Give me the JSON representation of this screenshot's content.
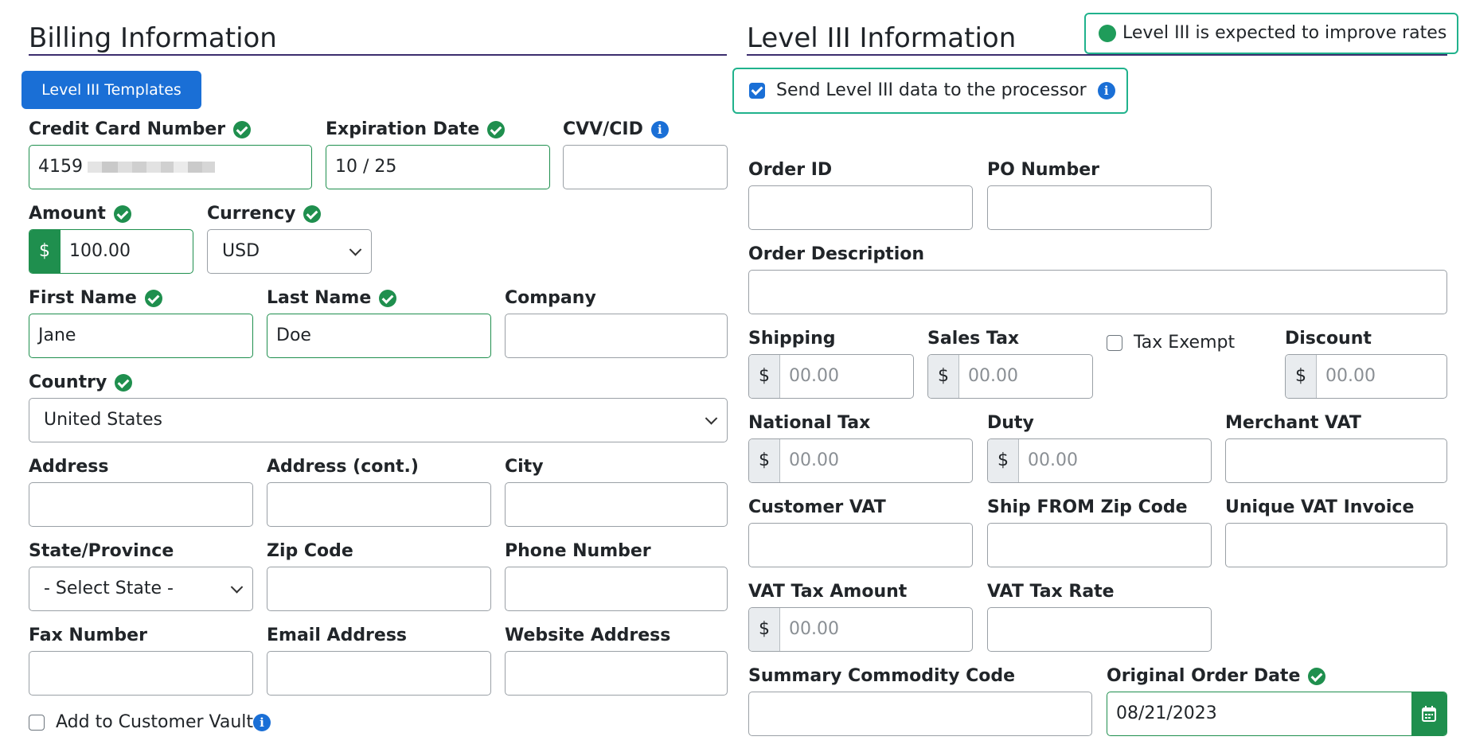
{
  "billing": {
    "title": "Billing Information",
    "templates_button": "Level III Templates",
    "fields": {
      "credit_card_number": {
        "label": "Credit Card Number",
        "value": "4159"
      },
      "expiration_date": {
        "label": "Expiration Date",
        "value": "10 / 25"
      },
      "cvv": {
        "label": "CVV/CID",
        "value": ""
      },
      "amount": {
        "label": "Amount",
        "currency_symbol": "$",
        "value": "100.00"
      },
      "currency": {
        "label": "Currency",
        "value": "USD"
      },
      "first_name": {
        "label": "First Name",
        "value": "Jane"
      },
      "last_name": {
        "label": "Last Name",
        "value": "Doe"
      },
      "company": {
        "label": "Company",
        "value": ""
      },
      "country": {
        "label": "Country",
        "value": "United States"
      },
      "address": {
        "label": "Address",
        "value": ""
      },
      "address_cont": {
        "label": "Address (cont.)",
        "value": ""
      },
      "city": {
        "label": "City",
        "value": ""
      },
      "state": {
        "label": "State/Province",
        "value": "- Select State -"
      },
      "zip": {
        "label": "Zip Code",
        "value": ""
      },
      "phone": {
        "label": "Phone Number",
        "value": ""
      },
      "fax": {
        "label": "Fax Number",
        "value": ""
      },
      "email": {
        "label": "Email Address",
        "value": ""
      },
      "website": {
        "label": "Website Address",
        "value": ""
      }
    },
    "add_to_vault": {
      "label": "Add to Customer Vault",
      "checked": false
    }
  },
  "level3": {
    "title": "Level III Information",
    "notice": "Level III is expected to improve rates",
    "send_checkbox": {
      "label": "Send Level III data to the processor",
      "checked": true
    },
    "currency_symbol": "$",
    "amount_placeholder": "00.00",
    "fields": {
      "order_id": "Order ID",
      "po_number": "PO Number",
      "order_description": "Order Description",
      "shipping": "Shipping",
      "sales_tax": "Sales Tax",
      "tax_exempt": "Tax Exempt",
      "discount": "Discount",
      "national_tax": "National Tax",
      "duty": "Duty",
      "merchant_vat": "Merchant VAT",
      "customer_vat": "Customer VAT",
      "ship_from_zip": "Ship FROM Zip Code",
      "unique_vat_invoice": "Unique VAT Invoice",
      "vat_tax_amount": "VAT Tax Amount",
      "vat_tax_rate": "VAT Tax Rate",
      "summary_commodity_code": "Summary Commodity Code",
      "original_order_date": {
        "label": "Original Order Date",
        "value": "08/21/2023"
      }
    }
  },
  "colors": {
    "valid": "#1f8f4e",
    "primary": "#1a6fd6",
    "notice_border": "#20b28c",
    "rule": "#3b2d6e"
  }
}
